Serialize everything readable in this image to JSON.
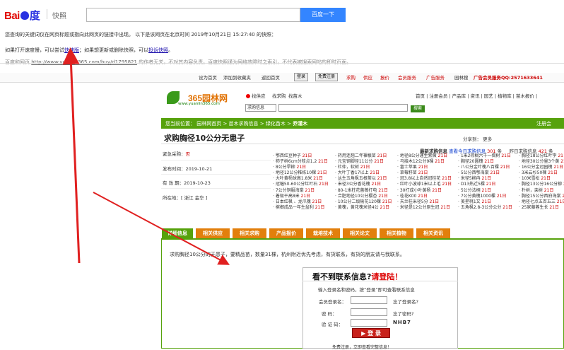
{
  "baidu": {
    "logo_bai": "Bai",
    "logo_du": "度",
    "kuaizhao": "快照",
    "search_button": "百度一下"
  },
  "notices": {
    "line1": "您查询的关键词仅在网页标题或指向此网页的链接中出现。 以下是该网页在北京时间 2019年10月21日 15:27:40 的快照：",
    "line2_a": "如果打开速度慢，可以尝试",
    "line2_link1": "快速版",
    "line2_b": "；如果想更新或删除快照，可以",
    "line2_link2": "投诉快照",
    "line2_c": "。",
    "line3_a": "百度和网页",
    "line3_link": "http://www.yuanlin365.com/buy/d1795821",
    "line3_b": "的作者无关，不对其内容负责。百度快照谨为网络故障时之索引，不代表被搜索网站的即时页面。"
  },
  "topbar": {
    "items": [
      "设为首页",
      "添加到收藏夹",
      "返回首页"
    ],
    "login": "登录",
    "register": "免费注册",
    "links_red": [
      "求购",
      "供应",
      "报价",
      "会员服务",
      "广告服务"
    ],
    "link_plain": "园林搜",
    "hotline": "广告会员服务QQ:2571633641"
  },
  "header": {
    "logo": "365园林网",
    "logo_url": "www.yuanlin365.com",
    "radio1": "找供应",
    "radio2": "找求购",
    "radio3": "找苗木",
    "select_value": "求购信息",
    "search_btn": "搜索",
    "nav": "首页 | 注册会员 | 产品库 | 资讯 | 园艺 | 植物库 | 苗木报价 |"
  },
  "breadcrumb": {
    "text": "您当前位置： 园林网首页 > 苗木求购信息 > 绿化苗木 >",
    "current": "乔灌木",
    "register": "注册会"
  },
  "page": {
    "title": "求购胸径10公分无患子",
    "share": "分享到：     更多"
  },
  "info": {
    "status_label": "紧急采购：",
    "status_value": "否",
    "publish_label": "发布时间：",
    "publish_value": "2019-10-21",
    "valid_label": "有 效 期：",
    "valid_value": "2019-10-23",
    "location_label": "所在地：",
    "location_value": "[ 浙江  金华 ]"
  },
  "listing": {
    "latest_label": "最新求购信息",
    "view_today": "查看今日求购信息",
    "count": "301",
    "unit": "条",
    "yesterday": "昨日求购信息",
    "ycount": "421",
    "yunit": "条",
    "columns": [
      [
        "鄂西红豆种子",
        "柿子树6cm分枝点1.2",
        "8公分旱柳",
        "地径12公分椎栋10棵",
        "大叶黄杨球高1.8米",
        "冠幅50-60公分红叶石",
        "7公分铜服海棠",
        "着极干高8米",
        "日本红枫 、龙爪槐",
        "槟榔成品一年生盆利"
      ],
      [
        "药用连翘二年裸根苗",
        "元宝钢脚径11公分",
        "杜仲，软树",
        "大叶丁香17以上",
        "丛生五角枫五根茶以",
        "米径3公分香花槐",
        "80-1米柱花蔷薇打电",
        "合肥地径10公分樱杏",
        "10公分二级榆花120棵",
        "黄槐，黄花槐米径4公"
      ],
      [
        "地径8公分速生紫薇",
        "马接木12公分9棵",
        "富士苹果",
        "草莓籽苗",
        "冠3.8以上自然冠桂花",
        "红叶小波球1米以上毛",
        "30打成小叶黄杨",
        "桂花K00",
        "天兰桂米径5分",
        "米径是12公分原生冠"
      ],
      [
        "1米2棕榈六千一偈树",
        "胸径20圆槐",
        "八公分金叶槐八百棵",
        "5公分西鄂海棠",
        "米径5柳冉",
        "D13热迁5棵",
        "5公分法桐",
        "7公分黄槐1000棵",
        "美星桃1又",
        "五角枫2.8-3公分公分"
      ],
      [
        "胸径18公分红叶李",
        "地径30公分量3个黄",
        "16公分金冠园槐",
        "3米云杉50棵",
        "10米雪松",
        "胸径13公分16公分柳",
        "朴树，栾树",
        "胸径15公分西府海棠",
        "地径七点五百五三",
        "25家藤蓉生长"
      ]
    ],
    "date": "21日"
  },
  "tabs": [
    "详细信息",
    "相关供应",
    "相关求购",
    "产品报价",
    "栽培技术",
    "相关论文",
    "相关植物",
    "相关资讯"
  ],
  "detail": {
    "desc": "求购胸径10公分的无患子，要精品苗，数量31棵，杭州附近优先考虑，有货联系，有货的朋友请与我联系。"
  },
  "login_box": {
    "heading_a": "看不到联系信息?",
    "heading_b": "请登陆！",
    "tip": "输入登录名和密码，按“登录”即可查看联系信息",
    "user_label": "会员登录名：",
    "forgot_user": "忘了登录名?",
    "pass_label": "密    码：",
    "forgot_pass": "忘了密码?",
    "captcha_label": "验 证 码：",
    "captcha_value": "NHB7",
    "login_btn": "登 录",
    "footer": "免费注册，立即查看完整信息！"
  },
  "colors": {
    "baidu_blue": "#3385ff",
    "green": "#56a20c",
    "orange": "#e27f0c",
    "red": "#c8221c",
    "arrow": "#e02020"
  }
}
